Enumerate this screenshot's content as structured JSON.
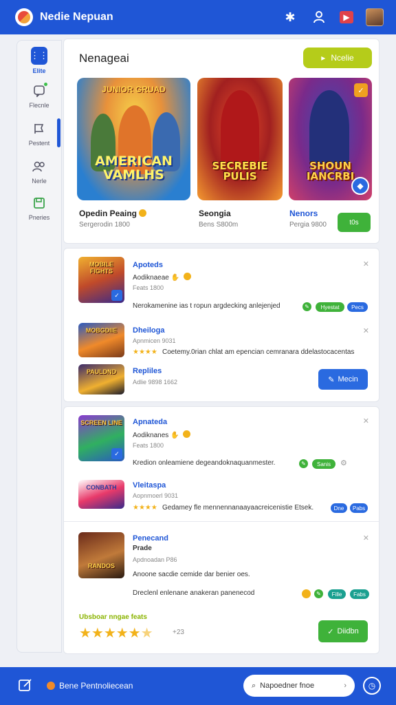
{
  "header": {
    "title": "Nedie Nepuan",
    "icons": [
      "puzzle-icon",
      "user-icon",
      "video-icon",
      "avatar"
    ]
  },
  "sidebar": {
    "items": [
      {
        "label": "Elite",
        "icon": "grid-icon",
        "active": true
      },
      {
        "label": "Flecnle",
        "icon": "chat-icon"
      },
      {
        "label": "Pestent",
        "icon": "flag-icon"
      },
      {
        "label": "Nerle",
        "icon": "group-icon"
      },
      {
        "label": "Pneries",
        "icon": "save-icon"
      }
    ]
  },
  "featured": {
    "title": "Nenageai",
    "action_label": "Ncelie",
    "cards": [
      {
        "art_title": "AMERICAN VAMLHS",
        "banner": "JUNIOR GRUAD",
        "name": "Opedin Peaing",
        "sub": "Sergerodin 1800"
      },
      {
        "art_title": "SECREBIE PULIS",
        "name": "Seongia",
        "sub": "Bens S800m"
      },
      {
        "art_title": "SHOUN IANCRBI",
        "name": "Nenors",
        "sub": "Pergia 9800"
      }
    ],
    "play_label": "t0s"
  },
  "list1": {
    "rows": [
      {
        "thumb_text": "MOBILE FIGHTS",
        "title": "Apoteds",
        "sub": "Aodiknaeae",
        "meta": "Feats 1800",
        "desc": "Nerokamenine ias t ropun argdecking anlejenjed",
        "tags": [
          "Hyestat",
          "Pecs"
        ]
      },
      {
        "thumb_text": "MOBGDIIE",
        "title": "Dheiloga",
        "meta": "Apnmicen 9031",
        "desc": "Coetemy.0rian chlat am epencian cemranara ddelastocacentas"
      },
      {
        "thumb_text": "PAULDND",
        "title": "Repliles",
        "meta": "Adlie 9898 1662",
        "btn": "Mecin"
      }
    ]
  },
  "list2": {
    "rows": [
      {
        "thumb_text": "SCREEN LINE",
        "title": "Apnateda",
        "sub": "Aodiknanes",
        "meta": "Feats 1800",
        "desc": "Kredion onleamiene degeandoknaquanmester.",
        "tag": "Sanis"
      },
      {
        "thumb_text": "CONBATH",
        "title": "Vleitaspa",
        "meta": "Aopnmoerl 9031",
        "desc": "Gedamey fle mennennanaayaacreicenistie Etsek.",
        "tags": [
          "Dne",
          "Pabs"
        ]
      },
      {
        "thumb_text": "RANDOS",
        "title": "Penecand",
        "sub": "Prade",
        "meta": "Apdnoadan P86",
        "desc": "Anoone sacdie cemide dar benier oes.",
        "desc2": "Dreclenl enlenane anakeran panenecod",
        "tags": [
          "Fille",
          "Fabs"
        ]
      }
    ],
    "rating_label": "Ubsboar nngae feats",
    "rating_value": 4.5,
    "rating_count": "+23",
    "rating_btn": "Diidbn"
  },
  "footer": {
    "left_text": "Bene Pentnoliecean",
    "search_label": "Napoedner fnoe"
  },
  "colors": {
    "brand_blue": "#1f56d6",
    "lime": "#b5cc1a",
    "green": "#3fb23a"
  }
}
